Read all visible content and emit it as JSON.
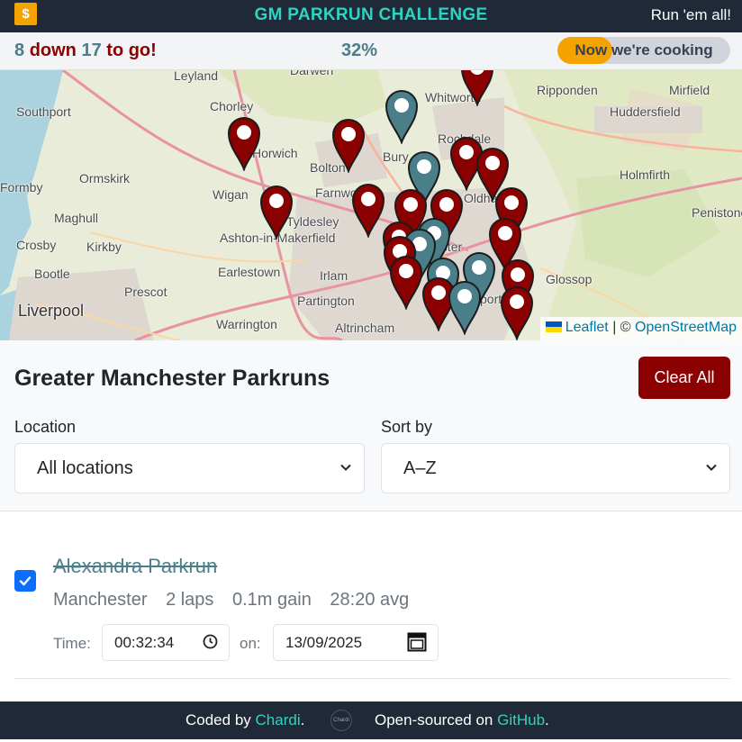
{
  "header": {
    "logo_glyph": "$",
    "title": "GM PARKRUN CHALLENGE",
    "tagline": "Run 'em all!"
  },
  "progress": {
    "done": "8",
    "down_label": "down",
    "remaining": "17",
    "to_go_label": "to go!",
    "percent_text": "32%",
    "fraction": 0.32,
    "pill_text": "Now we're cooking",
    "fill_color": "#f5a300"
  },
  "map": {
    "places": [
      "Leyland",
      "Darwen",
      "Whitworth",
      "Ripponden",
      "Mirfield",
      "Huddersfield",
      "Southport",
      "Chorley",
      "Rochdale",
      "Horwich",
      "Bolton",
      "Bury",
      "Ormskirk",
      "Holmfirth",
      "Formby",
      "Wigan",
      "Farnworth",
      "Oldham",
      "Penistone",
      "Maghull",
      "Tyldesley",
      "Ashton-in-Makerfield",
      "Crosby",
      "Kirkby",
      "Earlestown",
      "Bootle",
      "Irlam",
      "Glossop",
      "Prescot",
      "Partington",
      "Liverpool",
      "Warrington",
      "Altrincham",
      "Manchester",
      "Stockport"
    ],
    "visited_color": "#4a7f8a",
    "unvisited_color": "#8b0000",
    "attribution": {
      "leaflet": "Leaflet",
      "separator": "| ©",
      "osm": "OpenStreetMap"
    }
  },
  "panel": {
    "title": "Greater Manchester Parkruns",
    "clear_button": "Clear All",
    "location_label": "Location",
    "location_value": "All locations",
    "sort_label": "Sort by",
    "sort_value": "A–Z"
  },
  "list": {
    "items": [
      {
        "name": "Alexandra Parkrun",
        "checked": true,
        "area": "Manchester",
        "laps": "2 laps",
        "gain": "0.1m gain",
        "avg": "28:20 avg",
        "time_label": "Time:",
        "time_value": "00:32:34",
        "on_label": "on:",
        "date_value": "13/09/2025"
      }
    ]
  },
  "footer": {
    "coded_by": "Coded by",
    "author": "Chardi",
    "period1": ".",
    "badge_text": "Chardi",
    "open_sourced": "Open-sourced on",
    "github": "GitHub",
    "period2": "."
  }
}
